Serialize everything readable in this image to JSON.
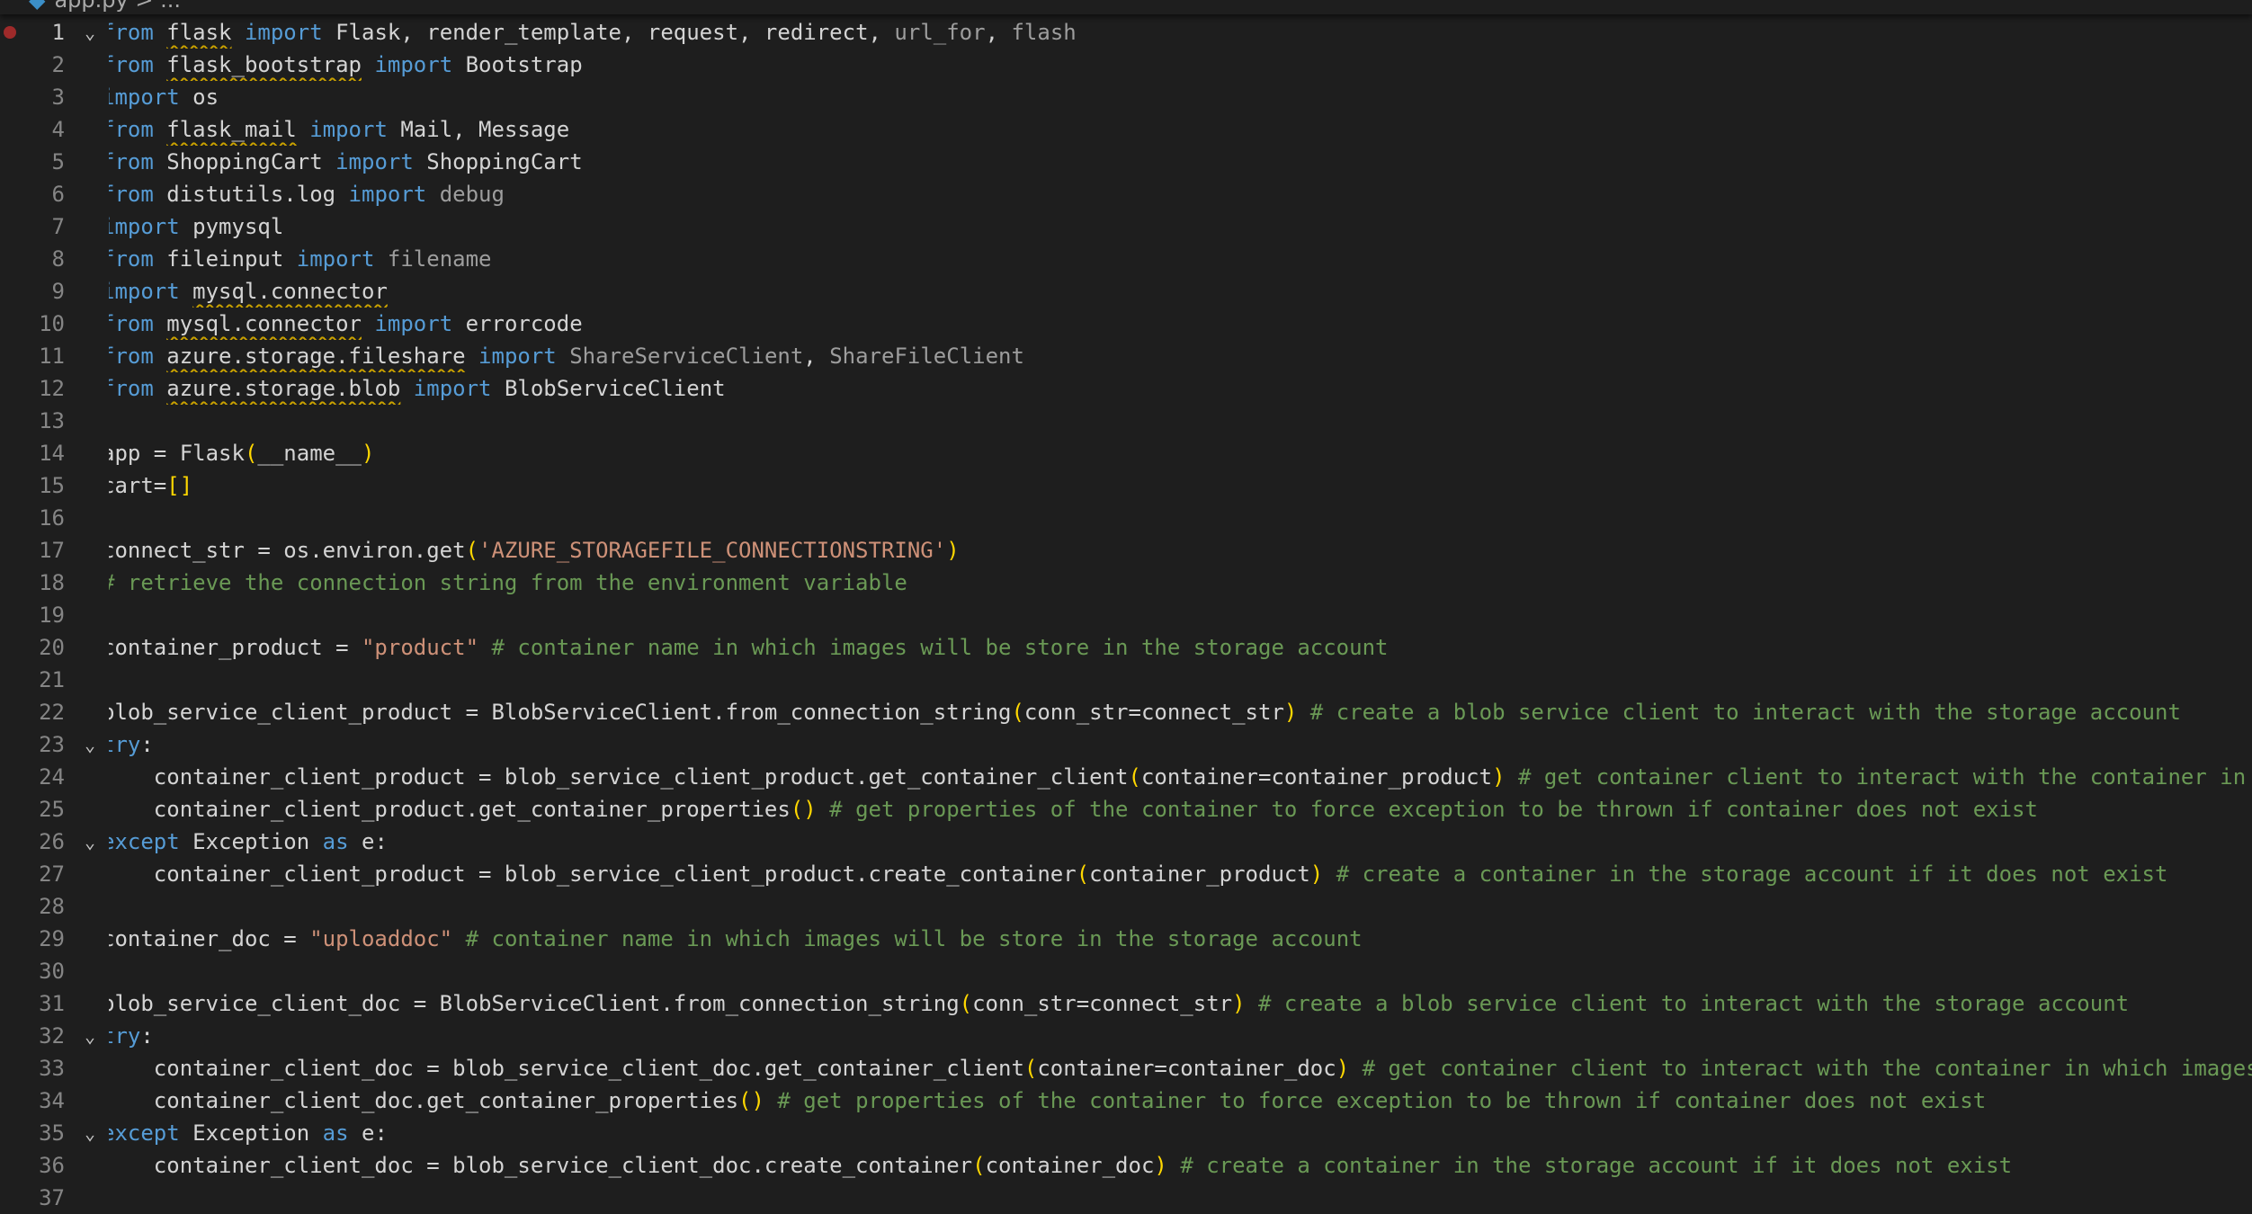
{
  "breadcrumb": {
    "text": "app.py > ...",
    "icon": "python-file-icon"
  },
  "colors": {
    "background": "#1e1e1e",
    "keyword": "#569cd6",
    "identifier": "#d4d4d4",
    "unused": "#9d9d9d",
    "string": "#ce9178",
    "comment": "#6a9955",
    "bracket": "#ffd700",
    "line_number": "#858585",
    "breakpoint": "#9e2a2a",
    "squiggle": "#c8a000"
  },
  "lines": [
    {
      "n": "1",
      "fold": true,
      "breakpoint": true,
      "tokens": [
        [
          "kw",
          "from"
        ],
        [
          "t",
          " "
        ],
        [
          "sq",
          "flask"
        ],
        [
          "t",
          " "
        ],
        [
          "kw",
          "import"
        ],
        [
          "t",
          " Flask, render_template, request, redirect, "
        ],
        [
          "dim",
          "url_for"
        ],
        [
          "t",
          ", "
        ],
        [
          "dim",
          "flash"
        ]
      ]
    },
    {
      "n": "2",
      "tokens": [
        [
          "kw",
          "from"
        ],
        [
          "t",
          " "
        ],
        [
          "sq",
          "flask_bootstrap"
        ],
        [
          "t",
          " "
        ],
        [
          "kw",
          "import"
        ],
        [
          "t",
          " Bootstrap"
        ]
      ]
    },
    {
      "n": "3",
      "tokens": [
        [
          "kw",
          "import"
        ],
        [
          "t",
          " os"
        ]
      ]
    },
    {
      "n": "4",
      "tokens": [
        [
          "kw",
          "from"
        ],
        [
          "t",
          " "
        ],
        [
          "sq",
          "flask_mail"
        ],
        [
          "t",
          " "
        ],
        [
          "kw",
          "import"
        ],
        [
          "t",
          " Mail, Message"
        ]
      ]
    },
    {
      "n": "5",
      "tokens": [
        [
          "kw",
          "from"
        ],
        [
          "t",
          " ShoppingCart "
        ],
        [
          "kw",
          "import"
        ],
        [
          "t",
          " ShoppingCart"
        ]
      ]
    },
    {
      "n": "6",
      "tokens": [
        [
          "kw",
          "from"
        ],
        [
          "t",
          " distutils.log "
        ],
        [
          "kw",
          "import"
        ],
        [
          "t",
          " "
        ],
        [
          "dim",
          "debug"
        ]
      ]
    },
    {
      "n": "7",
      "tokens": [
        [
          "kw",
          "import"
        ],
        [
          "t",
          " pymysql"
        ]
      ]
    },
    {
      "n": "8",
      "tokens": [
        [
          "kw",
          "from"
        ],
        [
          "t",
          " fileinput "
        ],
        [
          "kw",
          "import"
        ],
        [
          "t",
          " "
        ],
        [
          "dim",
          "filename"
        ]
      ]
    },
    {
      "n": "9",
      "tokens": [
        [
          "kw",
          "import"
        ],
        [
          "t",
          " "
        ],
        [
          "sq",
          "mysql.connector"
        ]
      ]
    },
    {
      "n": "10",
      "tokens": [
        [
          "kw",
          "from"
        ],
        [
          "t",
          " "
        ],
        [
          "sq",
          "mysql.connector"
        ],
        [
          "t",
          " "
        ],
        [
          "kw",
          "import"
        ],
        [
          "t",
          " errorcode"
        ]
      ]
    },
    {
      "n": "11",
      "tokens": [
        [
          "kw",
          "from"
        ],
        [
          "t",
          " "
        ],
        [
          "sq",
          "azure.storage.fileshare"
        ],
        [
          "t",
          " "
        ],
        [
          "kw",
          "import"
        ],
        [
          "t",
          " "
        ],
        [
          "dim",
          "ShareServiceClient"
        ],
        [
          "t",
          ", "
        ],
        [
          "dim",
          "ShareFileClient"
        ]
      ]
    },
    {
      "n": "12",
      "tokens": [
        [
          "kw",
          "from"
        ],
        [
          "t",
          " "
        ],
        [
          "sq",
          "azure.storage.blob"
        ],
        [
          "t",
          " "
        ],
        [
          "kw",
          "import"
        ],
        [
          "t",
          " BlobServiceClient"
        ]
      ]
    },
    {
      "n": "13",
      "tokens": []
    },
    {
      "n": "14",
      "tokens": [
        [
          "t",
          "app = Flask"
        ],
        [
          "br",
          "("
        ],
        [
          "t",
          "__name__"
        ],
        [
          "br",
          ")"
        ]
      ]
    },
    {
      "n": "15",
      "tokens": [
        [
          "t",
          "cart="
        ],
        [
          "br",
          "[]"
        ]
      ]
    },
    {
      "n": "16",
      "tokens": []
    },
    {
      "n": "17",
      "tokens": [
        [
          "t",
          "connect_str = os.environ.get"
        ],
        [
          "br",
          "("
        ],
        [
          "str",
          "'AZURE_STORAGEFILE_CONNECTIONSTRING'"
        ],
        [
          "br",
          ")"
        ]
      ]
    },
    {
      "n": "18",
      "tokens": [
        [
          "cmt",
          "# retrieve the connection string from the environment variable"
        ]
      ]
    },
    {
      "n": "19",
      "tokens": []
    },
    {
      "n": "20",
      "tokens": [
        [
          "t",
          "container_product = "
        ],
        [
          "str",
          "\"product\""
        ],
        [
          "t",
          " "
        ],
        [
          "cmt",
          "# container name in which images will be store in the storage account"
        ]
      ]
    },
    {
      "n": "21",
      "tokens": []
    },
    {
      "n": "22",
      "tokens": [
        [
          "t",
          "blob_service_client_product = BlobServiceClient.from_connection_string"
        ],
        [
          "br",
          "("
        ],
        [
          "t",
          "conn_str=connect_str"
        ],
        [
          "br",
          ")"
        ],
        [
          "t",
          " "
        ],
        [
          "cmt",
          "# create a blob service client to interact with the storage account"
        ]
      ]
    },
    {
      "n": "23",
      "fold": true,
      "tokens": [
        [
          "kw",
          "try"
        ],
        [
          "t",
          ":"
        ]
      ]
    },
    {
      "n": "24",
      "tokens": [
        [
          "t",
          "    container_client_product = blob_service_client_product.get_container_client"
        ],
        [
          "br",
          "("
        ],
        [
          "t",
          "container=container_product"
        ],
        [
          "br",
          ")"
        ],
        [
          "t",
          " "
        ],
        [
          "cmt",
          "# get container client to interact with the container in which images will be stored"
        ]
      ]
    },
    {
      "n": "25",
      "tokens": [
        [
          "t",
          "    container_client_product.get_container_properties"
        ],
        [
          "br",
          "()"
        ],
        [
          "t",
          " "
        ],
        [
          "cmt",
          "# get properties of the container to force exception to be thrown if container does not exist"
        ]
      ]
    },
    {
      "n": "26",
      "fold": true,
      "tokens": [
        [
          "kw",
          "except"
        ],
        [
          "t",
          " Exception "
        ],
        [
          "kw",
          "as"
        ],
        [
          "t",
          " e:"
        ]
      ]
    },
    {
      "n": "27",
      "tokens": [
        [
          "t",
          "    container_client_product = blob_service_client_product.create_container"
        ],
        [
          "br",
          "("
        ],
        [
          "t",
          "container_product"
        ],
        [
          "br",
          ")"
        ],
        [
          "t",
          " "
        ],
        [
          "cmt",
          "# create a container in the storage account if it does not exist"
        ]
      ]
    },
    {
      "n": "28",
      "tokens": []
    },
    {
      "n": "29",
      "tokens": [
        [
          "t",
          "container_doc = "
        ],
        [
          "str",
          "\"uploaddoc\""
        ],
        [
          "t",
          " "
        ],
        [
          "cmt",
          "# container name in which images will be store in the storage account"
        ]
      ]
    },
    {
      "n": "30",
      "tokens": []
    },
    {
      "n": "31",
      "tokens": [
        [
          "t",
          "blob_service_client_doc = BlobServiceClient.from_connection_string"
        ],
        [
          "br",
          "("
        ],
        [
          "t",
          "conn_str=connect_str"
        ],
        [
          "br",
          ")"
        ],
        [
          "t",
          " "
        ],
        [
          "cmt",
          "# create a blob service client to interact with the storage account"
        ]
      ]
    },
    {
      "n": "32",
      "fold": true,
      "tokens": [
        [
          "kw",
          "try"
        ],
        [
          "t",
          ":"
        ]
      ]
    },
    {
      "n": "33",
      "tokens": [
        [
          "t",
          "    container_client_doc = blob_service_client_doc.get_container_client"
        ],
        [
          "br",
          "("
        ],
        [
          "t",
          "container=container_doc"
        ],
        [
          "br",
          ")"
        ],
        [
          "t",
          " "
        ],
        [
          "cmt",
          "# get container client to interact with the container in which images will be stored"
        ]
      ]
    },
    {
      "n": "34",
      "tokens": [
        [
          "t",
          "    container_client_doc.get_container_properties"
        ],
        [
          "br",
          "()"
        ],
        [
          "t",
          " "
        ],
        [
          "cmt",
          "# get properties of the container to force exception to be thrown if container does not exist"
        ]
      ]
    },
    {
      "n": "35",
      "fold": true,
      "tokens": [
        [
          "kw",
          "except"
        ],
        [
          "t",
          " Exception "
        ],
        [
          "kw",
          "as"
        ],
        [
          "t",
          " e:"
        ]
      ]
    },
    {
      "n": "36",
      "tokens": [
        [
          "t",
          "    container_client_doc = blob_service_client_doc.create_container"
        ],
        [
          "br",
          "("
        ],
        [
          "t",
          "container_doc"
        ],
        [
          "br",
          ")"
        ],
        [
          "t",
          " "
        ],
        [
          "cmt",
          "# create a container in the storage account if it does not exist"
        ]
      ]
    },
    {
      "n": "37",
      "tokens": []
    }
  ]
}
